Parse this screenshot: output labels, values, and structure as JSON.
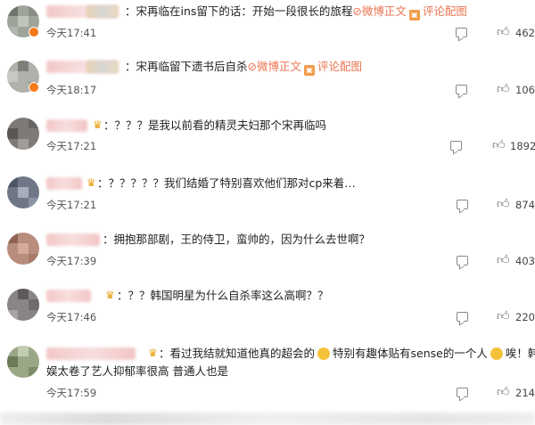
{
  "comments": [
    {
      "text_parts": [
        "：宋再临在ins留下的话：开始一段很长的旅程",
        "微博正文",
        "评论配图"
      ],
      "time": "今天17:41",
      "likes": "462"
    },
    {
      "text_parts": [
        "：宋再临留下遗书后自杀",
        "微博正文",
        "评论配图"
      ],
      "time": "今天18:17",
      "likes": "106"
    },
    {
      "text": "：？？？是我以前看的精灵夫妇那个宋再临吗",
      "time": "今天17:21",
      "likes": "1892"
    },
    {
      "text": "：？？？？？我们结婚了特别喜欢他们那对cp来着…",
      "time": "今天17:21",
      "likes": "874"
    },
    {
      "text": "：拥抱那部剧，王的侍卫，蛮帅的，因为什么去世啊？",
      "time": "今天17:39",
      "likes": "403"
    },
    {
      "text": "：？？韩国明星为什么自杀率这么高啊？？",
      "time": "今天17:46",
      "likes": "220"
    },
    {
      "text_line1_a": "：看过我结就知道他真的超会的",
      "text_line1_b": "特别有趣体贴有sense的一个人",
      "text_line1_c": "唉！韩",
      "text_line2": "娱太卷了艺人抑郁率很高 普通人也是",
      "time": "今天17:59",
      "likes": "214"
    }
  ],
  "icons": {
    "comment": "comment-icon",
    "like": "thumbs-up-icon",
    "weibo_link": "link-icon",
    "picture": "image-icon",
    "crown": "crown-icon"
  },
  "colors": {
    "link": "#eb7350",
    "verified_badge": "#f57a1a"
  }
}
